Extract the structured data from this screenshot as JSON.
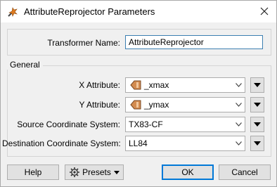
{
  "window": {
    "title": "AttributeReprojector Parameters"
  },
  "transformer": {
    "label": "Transformer Name:",
    "value": "AttributeReprojector"
  },
  "general": {
    "title": "General",
    "fields": [
      {
        "label": "X Attribute:",
        "value": "_xmax",
        "icon": "attribute-icon"
      },
      {
        "label": "Y Attribute:",
        "value": "_ymax",
        "icon": "attribute-icon"
      },
      {
        "label": "Source Coordinate System:",
        "value": "TX83-CF"
      },
      {
        "label": "Destination Coordinate System:",
        "value": "LL84"
      }
    ]
  },
  "footer": {
    "help": "Help",
    "presets": "Presets",
    "ok": "OK",
    "cancel": "Cancel"
  },
  "colors": {
    "focus_border": "#3c7fb1",
    "default_button_border": "#0078d7",
    "attribute_icon": "#c9834a"
  }
}
